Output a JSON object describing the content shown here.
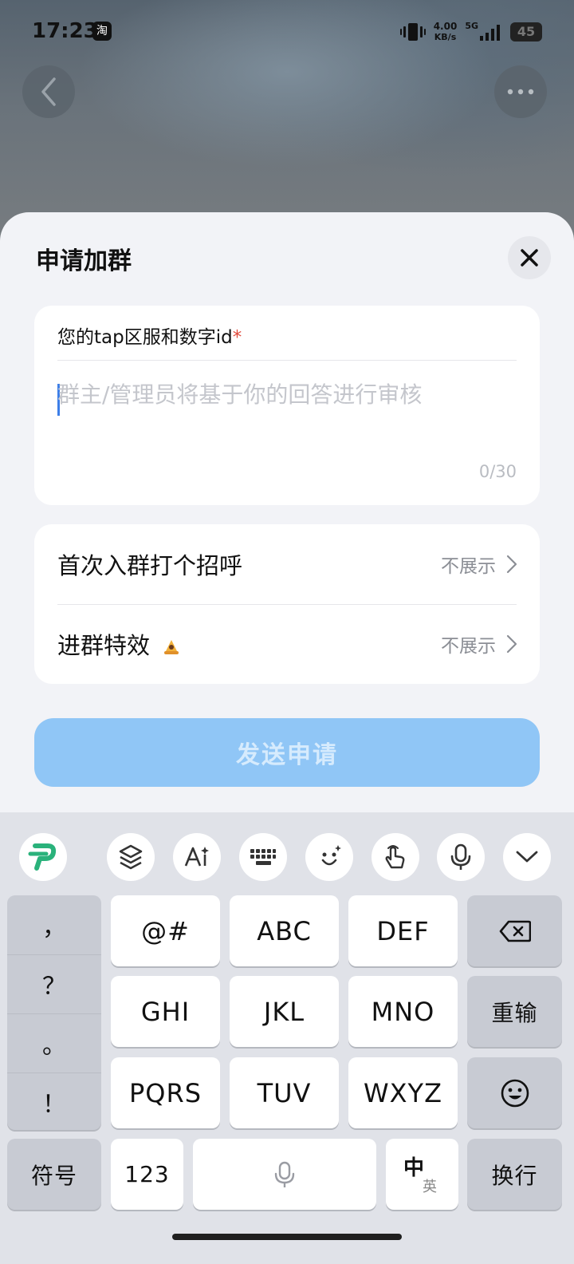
{
  "status_bar": {
    "time": "17:23",
    "app_icon_label": "淘",
    "speed_value": "4.00",
    "speed_unit": "KB/s",
    "network": "5G",
    "battery": "45"
  },
  "sheet": {
    "title": "申请加群",
    "question_label": "您的tap区服和数字id",
    "required_mark": "*",
    "answer_placeholder": "群主/管理员将基于你的回答进行审核",
    "answer_value": "",
    "char_counter": "0/30",
    "options": [
      {
        "label": "首次入群打个招呼",
        "value": "不展示"
      },
      {
        "label": "进群特效",
        "value": "不展示"
      }
    ],
    "send_label": "发送申请"
  },
  "keyboard": {
    "toolbar_icons": [
      "app-logo-icon",
      "switch-icon",
      "ai-icon",
      "keyboard-icon",
      "emoji-face-icon",
      "gesture-icon",
      "microphone-icon",
      "chevron-down-icon"
    ],
    "punctuation": [
      "，",
      "？",
      "。",
      "！"
    ],
    "rows": [
      [
        "@#",
        "ABC",
        "DEF"
      ],
      [
        "GHI",
        "JKL",
        "MNO"
      ],
      [
        "PQRS",
        "TUV",
        "WXYZ"
      ]
    ],
    "reenter_label": "重输",
    "symbols_label": "符号",
    "numbers_label": "123",
    "lang_cn": "中",
    "lang_en": "英",
    "newline_label": "换行"
  },
  "colors": {
    "primary_disabled": "#90c6f6",
    "required": "#e04a3c",
    "caret": "#3c7ee8",
    "app_logo": "#2ab27b"
  }
}
